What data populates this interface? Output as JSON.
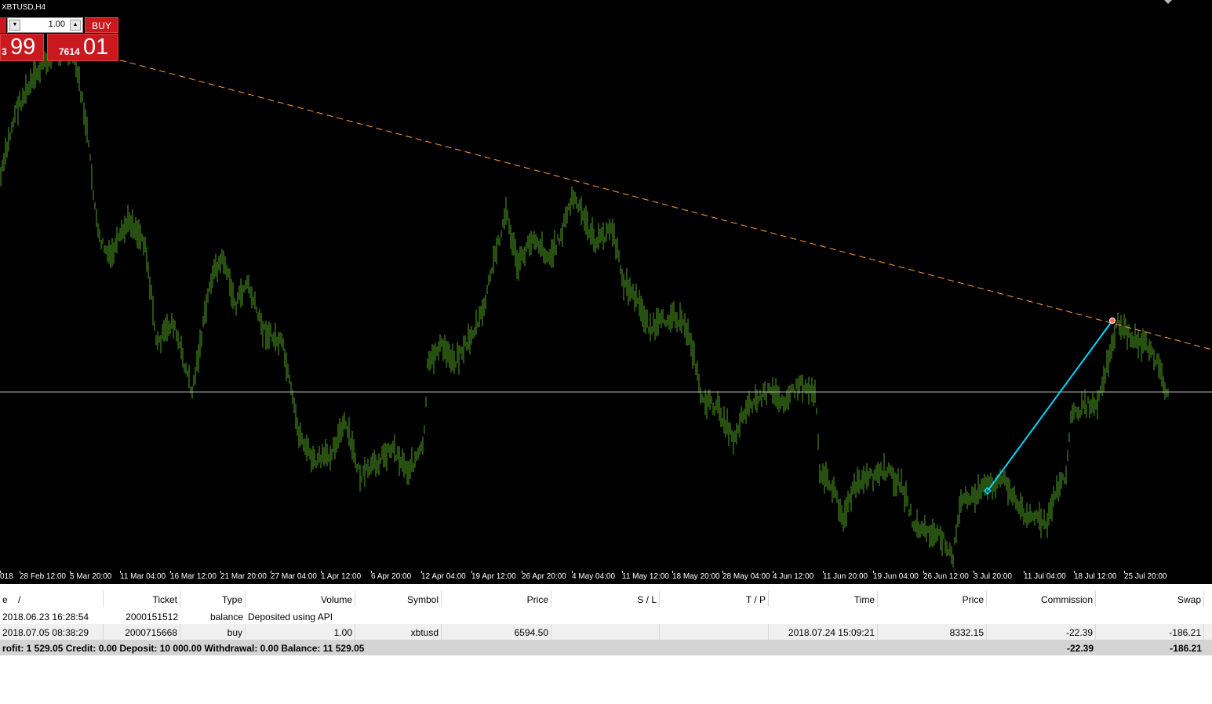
{
  "chart": {
    "symbol": "XBTUSD,H4",
    "colors": {
      "background": "#000000",
      "bars": "#4fa020",
      "trendline": "#ff9f40",
      "level": "#b4b4b4",
      "trade_line": "#00d8ff"
    },
    "time_labels": [
      "018",
      "28 Feb 12:00",
      "5 Mar 20:00",
      "11 Mar 04:00",
      "16 Mar 12:00",
      "21 Mar 20:00",
      "27 Mar 04:00",
      "1 Apr 12:00",
      "6 Apr 20:00",
      "12 Apr 04:00",
      "19 Apr 12:00",
      "26 Apr 20:00",
      "4 May 04:00",
      "11 May 12:00",
      "18 May 20:00",
      "28 May 04:00",
      "4 Jun 12:00",
      "11 Jun 20:00",
      "19 Jun 04:00",
      "26 Jun 12:00",
      "3 Jul 20:00",
      "11 Jul 04:00",
      "18 Jul 12:00",
      "25 Jul 20:00"
    ]
  },
  "one_click": {
    "lot_value": "1.00",
    "lot_down_icon": "arrow-down-icon",
    "lot_up_icon": "arrow-up-icon",
    "buy_label": "BUY",
    "sell_price_small": "3",
    "sell_price_big": "99",
    "buy_price_small": "7614",
    "buy_price_big": "01"
  },
  "terminal": {
    "headers": {
      "time": "e",
      "sort_icon": "/",
      "ticket": "Ticket",
      "type": "Type",
      "volume": "Volume",
      "symbol": "Symbol",
      "price": "Price",
      "sl": "S / L",
      "tp": "T / P",
      "close_time": "Time",
      "close_price": "Price",
      "commission": "Commission",
      "swap": "Swap"
    },
    "rows": [
      {
        "time": "2018.06.23 16:28:54",
        "ticket": "2000151512",
        "type": "balance",
        "comment": "Deposited using API"
      },
      {
        "time": "2018.07.05 08:38:29",
        "ticket": "2000715668",
        "type": "buy",
        "volume": "1.00",
        "symbol": "xbtusd",
        "price": "6594.50",
        "close_time": "2018.07.24 15:09:21",
        "close_price": "8332.15",
        "commission": "-22.39",
        "swap": "-186.21"
      }
    ],
    "summary": {
      "text": "rofit: 1 529.05  Credit: 0.00  Deposit: 10 000.00  Withdrawal: 0.00  Balance: 11 529.05",
      "commission": "-22.39",
      "swap": "-186.21"
    }
  }
}
